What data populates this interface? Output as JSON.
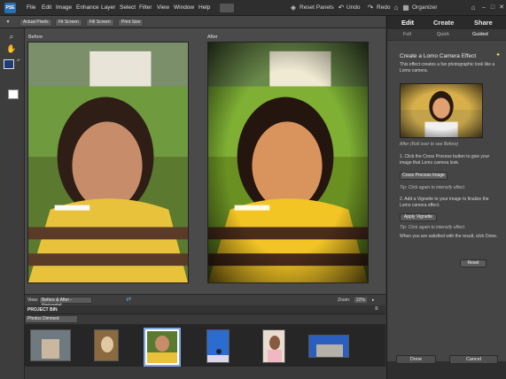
{
  "menu": {
    "app_icon": "PSE",
    "items": [
      "File",
      "Edit",
      "Image",
      "Enhance",
      "Layer",
      "Select",
      "Filter",
      "View",
      "Window",
      "Help"
    ],
    "reset_panels": "Reset Panels",
    "undo": "Undo",
    "redo": "Redo",
    "organizer": "Organizer"
  },
  "options_bar": {
    "buttons": [
      "Actual Pixels",
      "Fit Screen",
      "Fill Screen",
      "Print Size"
    ]
  },
  "canvas": {
    "before_label": "Before",
    "after_label": "After"
  },
  "view_bar": {
    "view_label": "View:",
    "view_value": "Before & After - Horizontal",
    "zoom_label": "Zoom:",
    "zoom_value": "22%"
  },
  "project_bin": {
    "title": "PROJECT BIN",
    "filter_value": "Photos Dimmed"
  },
  "panel": {
    "tabs": [
      "Edit",
      "Create",
      "Share"
    ],
    "subtabs": [
      "Full",
      "Quick",
      "Guided"
    ],
    "title": "Create a Lomo Camera Effect",
    "intro": "This effect creates a fun photographic look like a Lomo camera.",
    "preview_caption": "After (Roll over to see Before)",
    "step1": "1. Click the Cross Process button to give your image that Lomo camera look.",
    "step1_button": "Cross Process Image",
    "tip1": "Tip: Click again to intensify effect",
    "step2": "2. Add a Vignette to your image to finalize the Lomo camera effect.",
    "step2_button": "Apply Vignette",
    "tip2": "Tip: Click again to intensify effect",
    "finish": "When you are satisfied with the result, click Done.",
    "reset": "Reset",
    "done": "Done",
    "cancel": "Cancel"
  },
  "colors": {
    "accent": "#2a6fb0",
    "foreground_swatch": "#1e3d78",
    "background_swatch": "#ffffff"
  }
}
